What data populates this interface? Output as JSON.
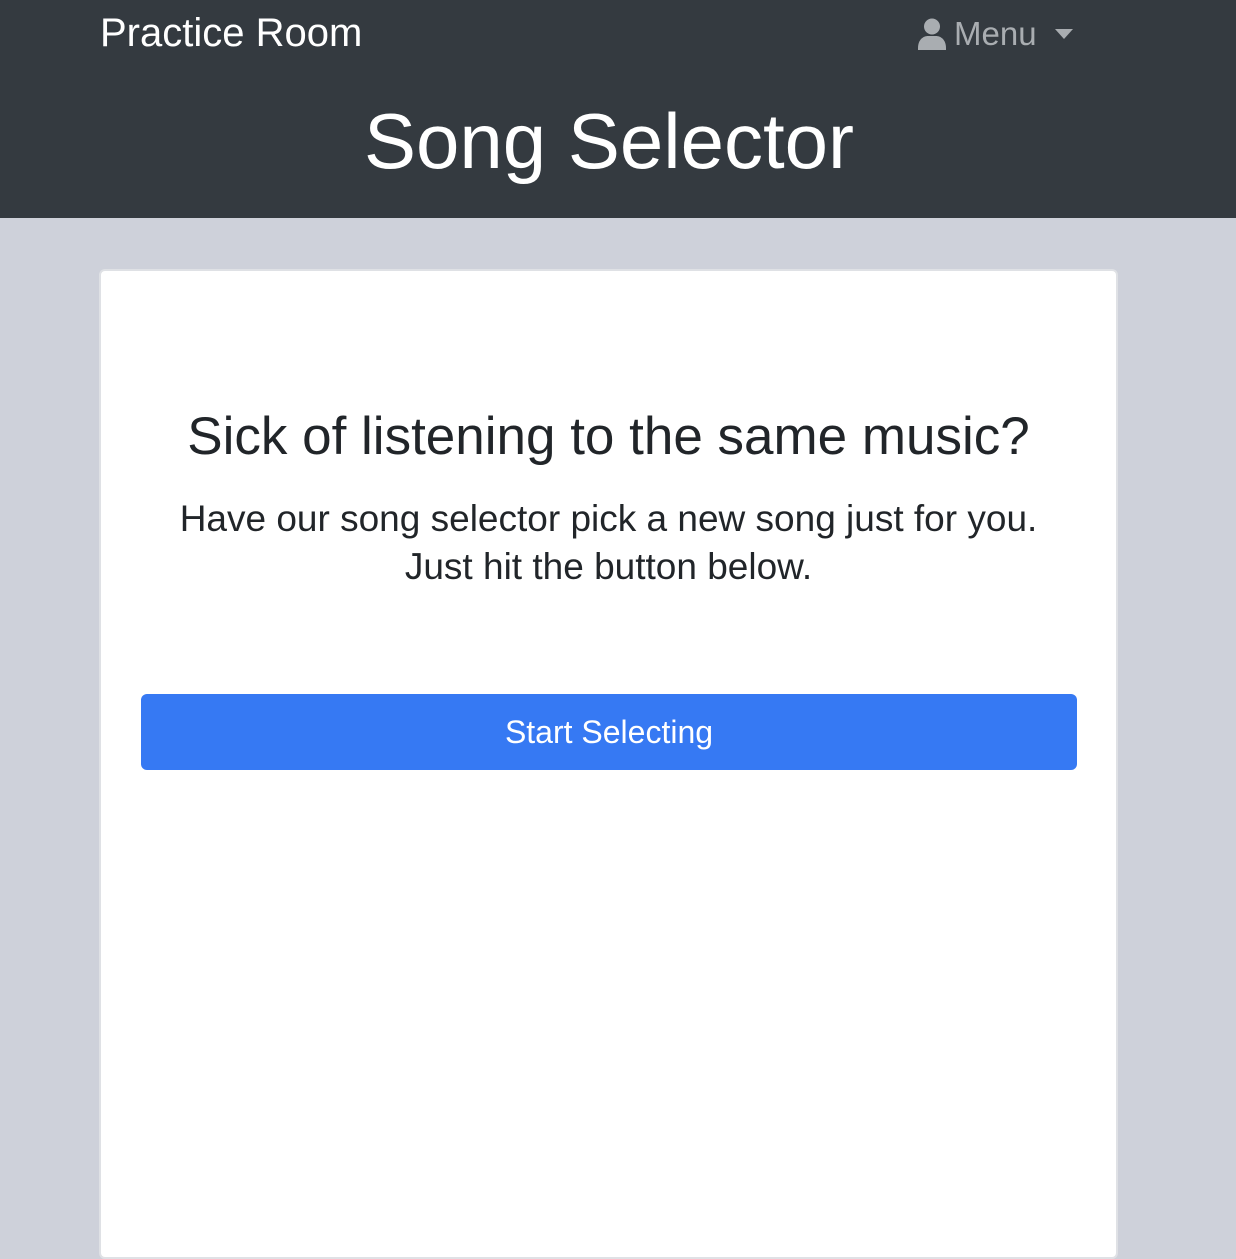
{
  "navbar": {
    "brand": "Practice Room",
    "menu_label": "Menu",
    "menu_icon": "user-icon",
    "menu_caret_icon": "caret-down-icon"
  },
  "header": {
    "title": "Song Selector"
  },
  "card": {
    "headline": "Sick of listening to the same music?",
    "line1": "Have our song selector pick a new song just for you.",
    "line2": "Just hit the button below.",
    "button_label": "Start Selecting"
  },
  "colors": {
    "navbar_bg": "#343a40",
    "page_bg": "#ced1da",
    "primary_button": "#3679f3",
    "menu_text": "#a9adb1"
  }
}
